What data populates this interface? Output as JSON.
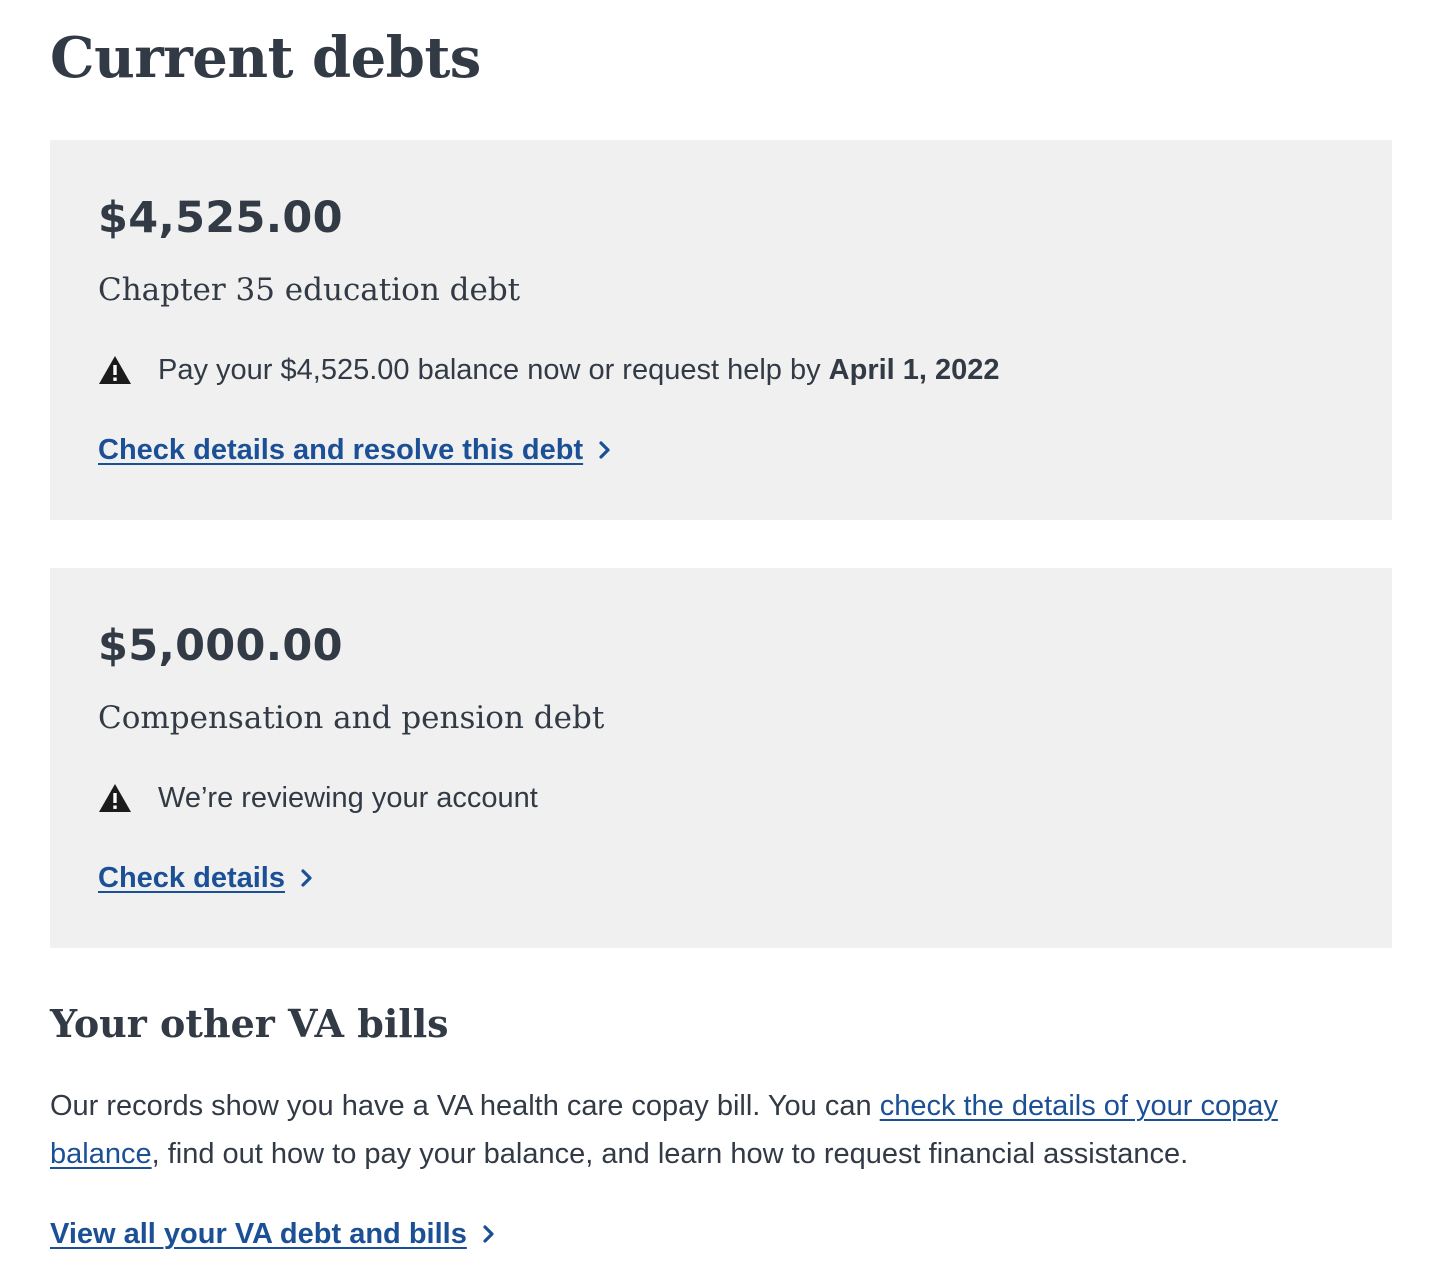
{
  "page": {
    "title": "Current debts"
  },
  "debts": [
    {
      "amount": "$4,525.00",
      "type": "Chapter 35 education debt",
      "alert_text": "Pay your $4,525.00 balance now or request help by ",
      "alert_bold": "April 1, 2022",
      "link_label": "Check details and resolve this debt"
    },
    {
      "amount": "$5,000.00",
      "type": "Compensation and pension debt",
      "alert_text": "We’re reviewing your account",
      "alert_bold": "",
      "link_label": "Check details"
    }
  ],
  "other_bills": {
    "title": "Your other VA bills",
    "body_before": "Our records show you have a VA health care copay bill. You can ",
    "body_link": "check the details of your copay balance",
    "body_after": ", find out how to pay your balance, and learn how to request financial assistance.",
    "view_all_label": "View all your VA debt and bills"
  },
  "icons": {
    "alert": "warning-triangle-icon",
    "chevron": "chevron-right-icon"
  },
  "colors": {
    "text": "#323a45",
    "link": "#1b4f96",
    "card_background": "#f0f0f0"
  }
}
